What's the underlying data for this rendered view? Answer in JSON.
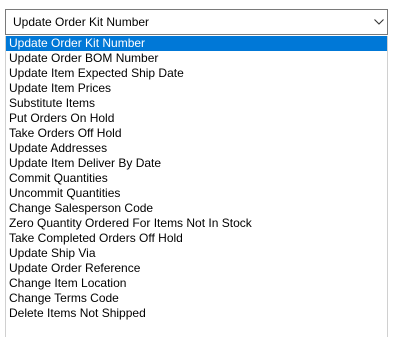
{
  "combo": {
    "value": "Update Order Kit Number",
    "arrow_icon": "chevron-down-icon"
  },
  "list": {
    "items": [
      {
        "label": "Update Order Kit Number",
        "selected": true
      },
      {
        "label": "Update Order BOM Number"
      },
      {
        "label": "Update Item Expected Ship Date"
      },
      {
        "label": "Update Item Prices"
      },
      {
        "label": "Substitute Items"
      },
      {
        "label": "Put Orders On Hold"
      },
      {
        "label": "Take Orders Off Hold"
      },
      {
        "label": "Update Addresses"
      },
      {
        "label": "Update Item Deliver By Date"
      },
      {
        "label": "Commit Quantities"
      },
      {
        "label": "Uncommit Quantities"
      },
      {
        "label": "Change Salesperson Code"
      },
      {
        "label": "Zero Quantity Ordered For Items Not In Stock"
      },
      {
        "label": "Take Completed Orders Off Hold"
      },
      {
        "label": "Update Ship Via"
      },
      {
        "label": "Update Order Reference"
      },
      {
        "label": "Change Item Location"
      },
      {
        "label": "Change Terms Code"
      },
      {
        "label": "Delete Items Not Shipped"
      }
    ]
  },
  "colors": {
    "selection": "#0078d7",
    "selection_text": "#ffffff",
    "border": "#7a7a7a"
  }
}
